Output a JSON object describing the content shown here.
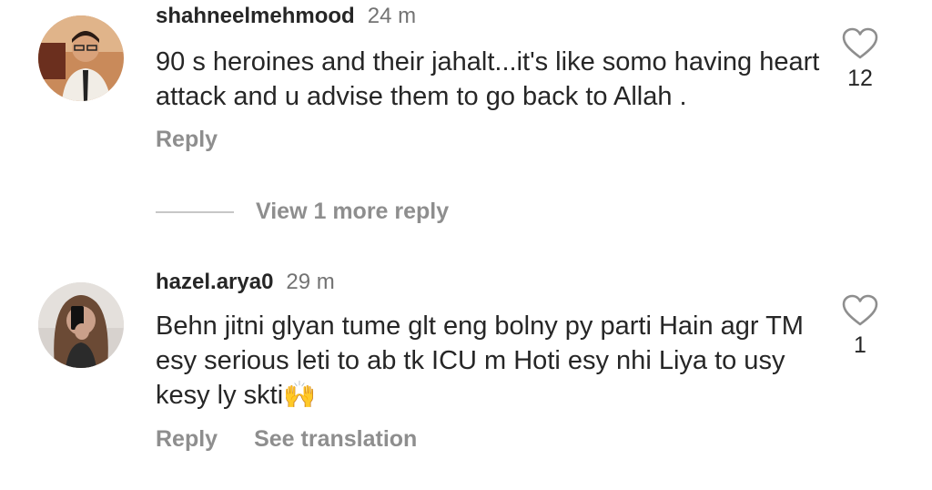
{
  "comments": [
    {
      "username": "shahneelmehmood",
      "time": "24 m",
      "text": "90 s heroines and their jahalt...it's like somo having heart attack and u advise them to go back to Allah .",
      "likes": "12",
      "reply_label": "Reply"
    },
    {
      "username": "hazel.arya0",
      "time": "29 m",
      "text": "Behn jitni glyan tume glt eng bolny py parti Hain agr TM esy serious leti to ab tk ICU m Hoti esy nhi Liya to usy kesy ly skti",
      "emoji": "🙌",
      "likes": "1",
      "reply_label": "Reply",
      "translate_label": "See translation"
    }
  ],
  "view_more_replies": "View 1 more reply",
  "colors": {
    "text": "#262626",
    "secondary": "#8e8e8e",
    "time": "#737373",
    "divider": "#c7c7c7"
  }
}
